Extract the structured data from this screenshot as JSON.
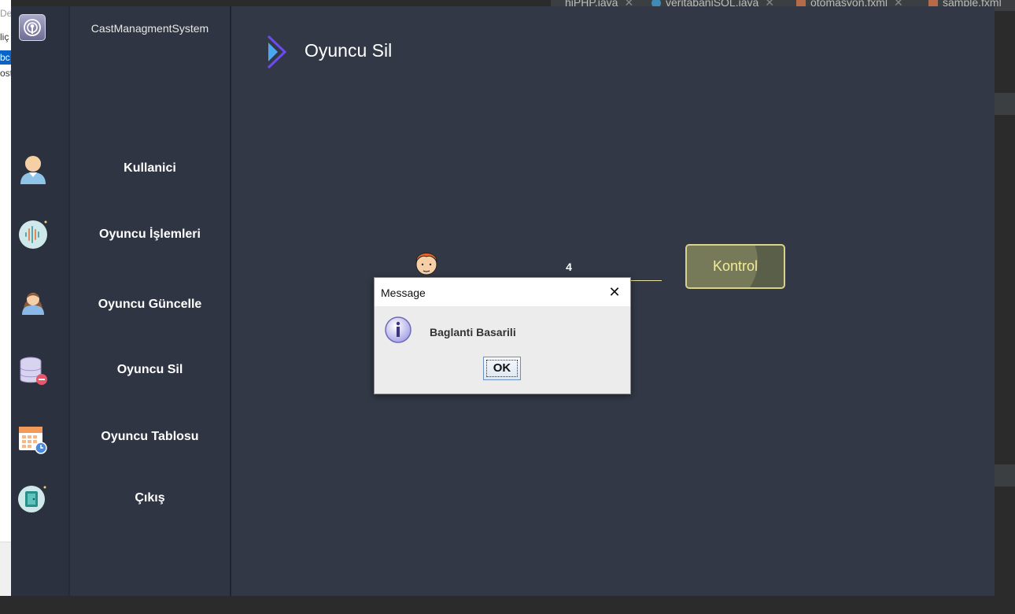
{
  "ide": {
    "tabs": [
      {
        "label": "hiPHP.java",
        "icon": "java-file-icon"
      },
      {
        "label": "veritabaniSQL.java",
        "icon": "java-class-icon"
      },
      {
        "label": "otomasyon.fxml",
        "icon": "fxml-file-icon"
      },
      {
        "label": "sample.fxml",
        "icon": "fxml-file-icon"
      }
    ]
  },
  "background_window": {
    "lines": [
      "De",
      "liç",
      "bc",
      "ost"
    ]
  },
  "app": {
    "name": "CastManagmentSystem",
    "logo_icon": "podcast-icon",
    "menu": [
      {
        "label": "Kullanici",
        "icon": "user-icon"
      },
      {
        "label": "Oyuncu İşlemleri",
        "icon": "audio-wave-icon"
      },
      {
        "label": "Oyuncu Güncelle",
        "icon": "woman-avatar-icon"
      },
      {
        "label": "Oyuncu Sil",
        "icon": "database-remove-icon"
      },
      {
        "label": "Oyuncu Tablosu",
        "icon": "calendar-clock-icon"
      },
      {
        "label": "Çıkış",
        "icon": "exit-door-icon"
      }
    ]
  },
  "page": {
    "title": "Oyuncu Sil",
    "title_icon": "chevron-right-icon",
    "count_label": "4",
    "kontrol_button": "Kontrol",
    "accent_color": "#e9e3a6"
  },
  "dialog": {
    "title": "Message",
    "close_glyph": "✕",
    "message": "Baglanti Basarili",
    "ok_label": "OK",
    "icon": "info-icon"
  }
}
